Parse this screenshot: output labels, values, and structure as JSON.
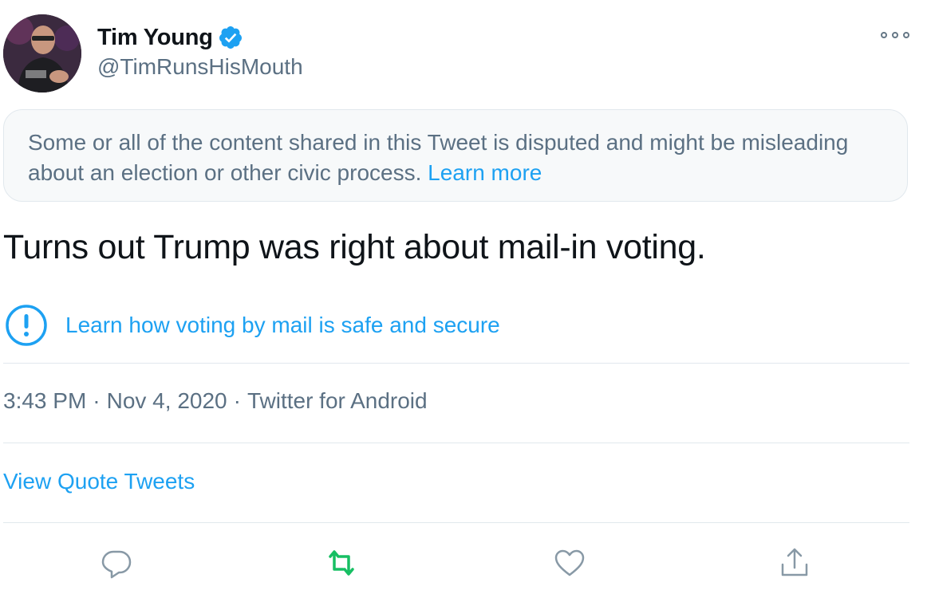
{
  "author": {
    "display_name": "Tim Young",
    "handle": "@TimRunsHisMouth",
    "verified": true
  },
  "notice": {
    "text": "Some or all of the content shared in this Tweet is disputed and might be misleading about an election or other civic process. ",
    "link_label": "Learn more"
  },
  "tweet": {
    "text": "Turns out Trump was right about mail-in voting."
  },
  "label": {
    "icon": "exclamation-circle-icon",
    "text": "Learn how voting by mail is safe and secure"
  },
  "meta": {
    "time": "3:43 PM",
    "separator": "·",
    "date": "Nov 4, 2020",
    "source": "Twitter for Android"
  },
  "quote_tweets_label": "View Quote Tweets",
  "actions": {
    "reply_icon": "reply-icon",
    "retweet_icon": "retweet-icon",
    "like_icon": "heart-icon",
    "share_icon": "share-icon"
  },
  "colors": {
    "accent": "#1da1f2",
    "retweet": "#17bf63",
    "secondary_text": "#5b7083",
    "border": "#e1e8ed"
  }
}
